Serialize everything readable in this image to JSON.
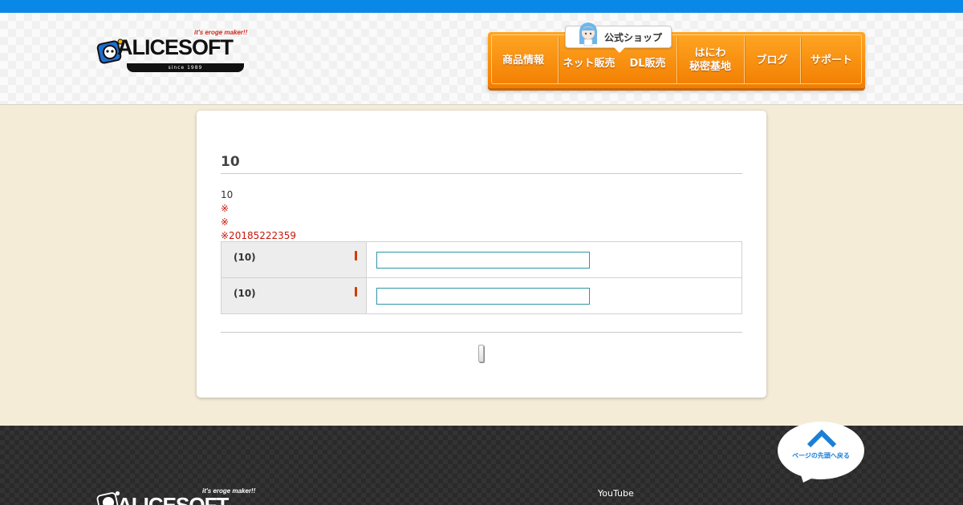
{
  "header": {
    "logo_tagline": "it's eroge maker!!",
    "logo_word": "ALICESOFT",
    "logo_since": "since 1989",
    "shop_badge": "公式ショップ",
    "nav": [
      {
        "label": "商品情報"
      },
      {
        "label": "ネット販売"
      },
      {
        "label": "DL販売"
      },
      {
        "label_line1": "はにわ",
        "label_line2": "秘密基地"
      },
      {
        "label": "ブログ"
      },
      {
        "label": "サポート"
      }
    ]
  },
  "main": {
    "title": "10",
    "intro": "10",
    "notes": [
      "※",
      "※",
      "※20185222359"
    ],
    "form": {
      "rows": [
        {
          "label": "(10)",
          "value": "",
          "placeholder": ""
        },
        {
          "label": "(10)",
          "value": "",
          "placeholder": ""
        }
      ]
    }
  },
  "footer": {
    "logo_tagline": "it's eroge maker!!",
    "logo_word": "ALICESOFT",
    "youtube": "YouTube",
    "page_top": "ページの先頭へ戻る"
  },
  "colors": {
    "top_bar": "#0a88e8",
    "nav_orange": "#f58a0c",
    "page_bg": "#f5ecd8",
    "note_red": "#c8160a",
    "input_border": "#2d97a7",
    "page_top_blue": "#1a7fd8"
  },
  "icons": {
    "logo_mascot": "alice-mascot-icon",
    "shop_girl": "shop-girl-icon",
    "page_top": "chevron-up-icon"
  }
}
